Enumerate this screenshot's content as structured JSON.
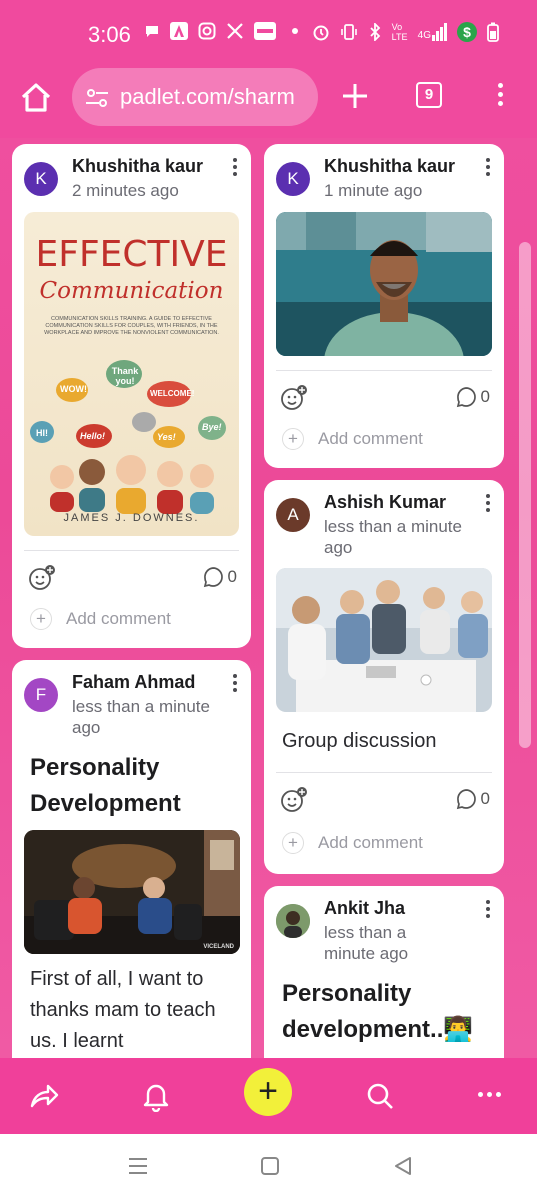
{
  "status": {
    "time": "3:06",
    "icons_left": [
      "chat-icon",
      "a-app-icon",
      "instagram-icon",
      "x-icon",
      "paytm-icon",
      "dot-icon"
    ],
    "icons_right": [
      "alarm-icon",
      "vibrate-icon",
      "bluetooth-icon",
      "volte-icon",
      "signal-4g-icon",
      "dollar-app-icon",
      "battery-icon"
    ],
    "volte": "Vo LTE",
    "network": "4G",
    "dollar": "$"
  },
  "browser": {
    "url": "padlet.com/sharm",
    "tab_count": "9"
  },
  "cards": [
    {
      "author": "Khushitha kaur",
      "avatar_letter": "K",
      "avatar_color": "#5b2fb0",
      "time": "2 minutes ago",
      "book": {
        "title_top": "EFFECTIVE",
        "title_script": "Communication",
        "subtitle": "COMMUNICATION SKILLS TRAINING. A GUIDE TO EFFECTIVE COMMUNICATION SKILLS FOR COUPLES, WITH FRIENDS, IN THE WORKPLACE AND IMPROVE THE NONVIOLENT COMMUNICATION.",
        "bubbles": [
          "WOW!",
          "Thank you!",
          "WELCOME!",
          "HI!",
          "Hello!",
          "Yes!",
          "Bye!"
        ],
        "author": "JAMES J. DOWNES."
      },
      "comment_count": "0",
      "add_comment": "Add comment"
    },
    {
      "author": "Khushitha kaur",
      "avatar_letter": "K",
      "avatar_color": "#5b2fb0",
      "time": "1 minute ago",
      "comment_count": "0",
      "add_comment": "Add comment"
    },
    {
      "author": "Faham Ahmad",
      "avatar_letter": "F",
      "avatar_color": "#a347c4",
      "time": "less than a minute ago",
      "heading": "Personality Development",
      "video_label": "VICELAND",
      "body": "First of all, I want to thanks mam to teach us. I learnt"
    },
    {
      "author": "Ashish Kumar",
      "avatar_letter": "A",
      "avatar_color": "#6b3a2a",
      "time": "less than a minute ago",
      "caption": "Group discussion",
      "comment_count": "0",
      "add_comment": "Add comment"
    },
    {
      "author": "Ankit Jha",
      "time": "less than a minute ago",
      "heading": "Personality development..👨‍💻"
    }
  ],
  "bottombar": {
    "items": [
      "share-icon",
      "bell-icon",
      "add-post-button",
      "search-icon",
      "more-icon"
    ],
    "fab": "+",
    "accent": "#f2f03a"
  },
  "navbar": {
    "items": [
      "recent-apps-icon",
      "home-icon",
      "back-icon"
    ]
  },
  "colors": {
    "board": "#ec4a98",
    "bar": "#f0409a"
  }
}
